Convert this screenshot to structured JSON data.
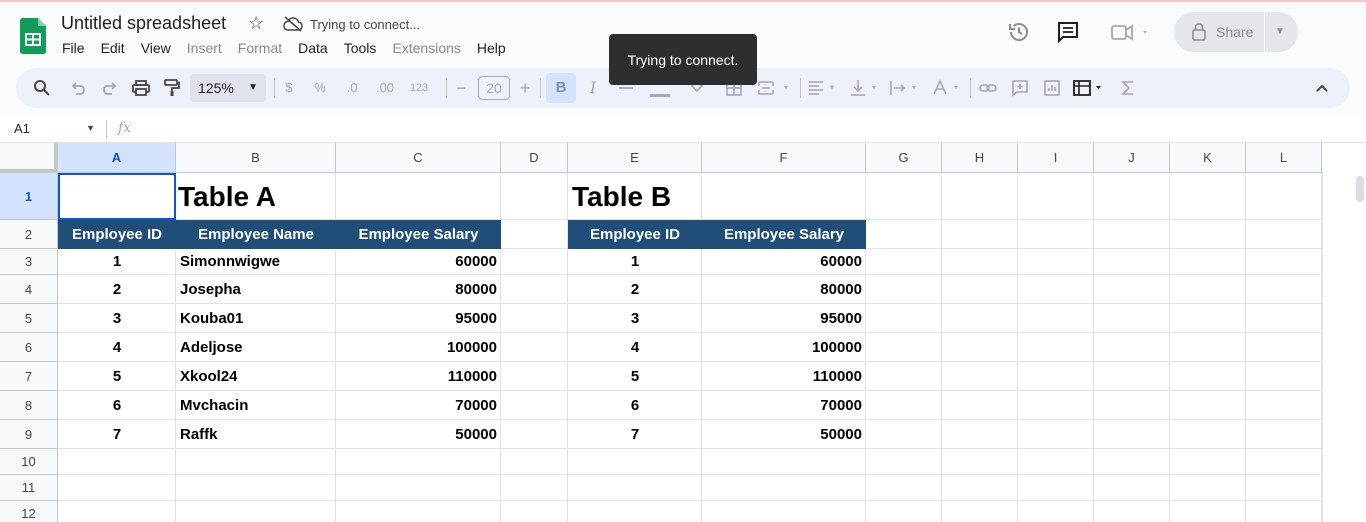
{
  "doc": {
    "title": "Untitled spreadsheet",
    "status": "Trying to connect..."
  },
  "menu": [
    "File",
    "Edit",
    "View",
    "Insert",
    "Format",
    "Data",
    "Tools",
    "Extensions",
    "Help"
  ],
  "menu_disabled": [
    "Insert",
    "Format",
    "Extensions"
  ],
  "tooltip": "Trying to connect.",
  "share": {
    "label": "Share"
  },
  "toolbar": {
    "zoom": "125%",
    "currency": "$",
    "percent": "%",
    "decrease_decimal": ".0",
    "increase_decimal": ".00",
    "number_format": "123",
    "font_size": "20",
    "minus": "−",
    "plus": "+",
    "bold": "B",
    "italic": "I",
    "sum": "Σ"
  },
  "formula_bar": {
    "name_box": "A1",
    "fx": "fx"
  },
  "columns": [
    "A",
    "B",
    "C",
    "D",
    "E",
    "F",
    "G",
    "H",
    "I",
    "J",
    "K",
    "L"
  ],
  "rows": [
    "1",
    "2",
    "3",
    "4",
    "5",
    "6",
    "7",
    "8",
    "9",
    "10",
    "11",
    "12"
  ],
  "sheet": {
    "table_a_title": "Table A",
    "table_b_title": "Table B",
    "table_a_headers": [
      "Employee ID",
      "Employee Name",
      "Employee Salary"
    ],
    "table_b_headers": [
      "Employee ID",
      "Employee Salary"
    ],
    "table_a_rows": [
      [
        "1",
        "Simonnwigwe",
        "60000"
      ],
      [
        "2",
        "Josepha",
        "80000"
      ],
      [
        "3",
        "Kouba01",
        "95000"
      ],
      [
        "4",
        "Adeljose",
        "100000"
      ],
      [
        "5",
        "Xkool24",
        "110000"
      ],
      [
        "6",
        "Mvchacin",
        "70000"
      ],
      [
        "7",
        "Raffk",
        "50000"
      ]
    ],
    "table_b_rows": [
      [
        "1",
        "60000"
      ],
      [
        "2",
        "80000"
      ],
      [
        "3",
        "95000"
      ],
      [
        "4",
        "100000"
      ],
      [
        "5",
        "110000"
      ],
      [
        "6",
        "70000"
      ],
      [
        "7",
        "50000"
      ]
    ]
  },
  "colors": {
    "header_band": "#1f4e79",
    "selection": "#0b57d0",
    "app_green": "#0f9d58"
  }
}
